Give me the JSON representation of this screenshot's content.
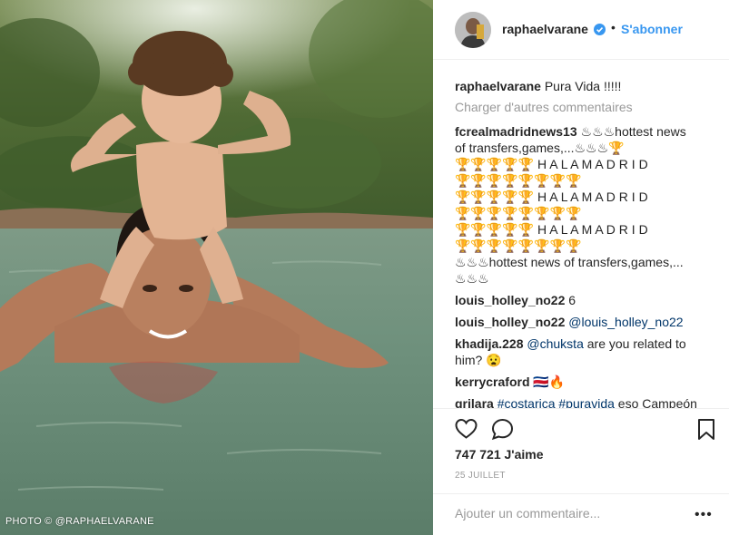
{
  "photo": {
    "credit": "PHOTO © @RAPHAELVARANE"
  },
  "header": {
    "username": "raphaelvarane",
    "separator": "•",
    "follow_label": "S'abonner",
    "verified_icon": "verified-badge-icon"
  },
  "caption": {
    "username": "raphaelvarane",
    "text": "Pura Vida !!!!!"
  },
  "load_more_label": "Charger d'autres commentaires",
  "comments": [
    {
      "username": "fcrealmadridnews13",
      "lines": [
        "♨♨♨hottest news",
        "of transfers,games,...♨♨♨🏆",
        "🏆🏆🏆🏆🏆 H A L A M A D R I D",
        "🏆🏆🏆🏆🏆🏆🏆🏆",
        "🏆🏆🏆🏆🏆 H A L A M A D R I D",
        "🏆🏆🏆🏆🏆🏆🏆🏆",
        "🏆🏆🏆🏆🏆 H A L A M A D R I D",
        "🏆🏆🏆🏆🏆🏆🏆🏆",
        "♨♨♨hottest news of transfers,games,...",
        "♨♨♨"
      ]
    },
    {
      "username": "louis_holley_no22",
      "text": "6"
    },
    {
      "username": "louis_holley_no22",
      "mention": "@louis_holley_no22",
      "text": ""
    },
    {
      "username": "khadija.228",
      "mention": "@chuksta",
      "text": "are you related to",
      "text2": "him? 😧"
    },
    {
      "username": "kerrycraford",
      "text": "🇨🇷🔥"
    },
    {
      "username": "grilara",
      "mention": "#costarica #puravida",
      "text": "eso Campeón"
    }
  ],
  "actions": {
    "like_icon": "heart-icon",
    "comment_icon": "comment-icon",
    "save_icon": "bookmark-icon"
  },
  "likes_text": "747 721 J'aime",
  "date_text": "25 JUILLET",
  "add_comment_placeholder": "Ajouter un commentaire...",
  "more_label": "•••",
  "colors": {
    "link_blue": "#3897f0",
    "mention_blue": "#003569",
    "muted_gray": "#999999",
    "text": "#262626"
  }
}
